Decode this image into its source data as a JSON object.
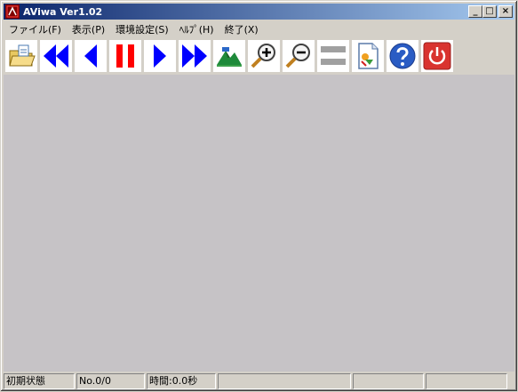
{
  "window": {
    "title": "AViwa Ver1.02"
  },
  "caption_buttons": {
    "minimize": "_",
    "maximize": "□",
    "close": "×"
  },
  "menu": [
    {
      "label": "ファイル(F)"
    },
    {
      "label": "表示(P)"
    },
    {
      "label": "環境設定(S)"
    },
    {
      "label": "ﾍﾙﾌﾟ(H)"
    },
    {
      "label": "終了(X)"
    }
  ],
  "toolbar": {
    "buttons": [
      {
        "icon": "open-folder-icon"
      },
      {
        "icon": "rewind-icon"
      },
      {
        "icon": "step-back-icon"
      },
      {
        "icon": "pause-icon"
      },
      {
        "icon": "step-forward-icon"
      },
      {
        "icon": "fast-forward-icon"
      },
      {
        "icon": "landscape-icon"
      },
      {
        "icon": "zoom-in-icon"
      },
      {
        "icon": "zoom-out-icon"
      },
      {
        "icon": "bars-icon"
      },
      {
        "icon": "document-icon"
      },
      {
        "icon": "help-icon"
      },
      {
        "icon": "power-icon"
      }
    ],
    "colors": {
      "blue": "#0000ff",
      "red": "#ff0000",
      "help": "#2a5cc4",
      "power": "#d9332f"
    }
  },
  "status": {
    "state": "初期状態",
    "number": "No.0/0",
    "time": "時間:0.0秒",
    "pane4": "",
    "pane5": "",
    "pane6": ""
  }
}
